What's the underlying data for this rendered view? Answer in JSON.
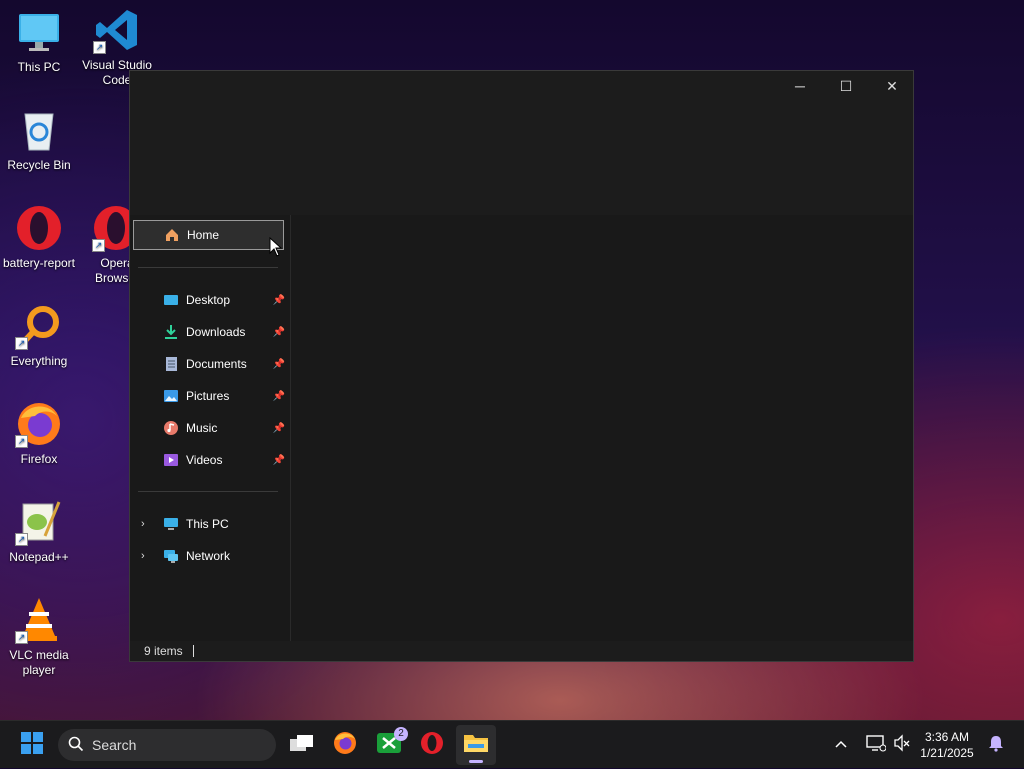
{
  "desktop": {
    "icons": [
      {
        "label": "This PC",
        "icon": "monitor-icon"
      },
      {
        "label": "Visual Studio Code",
        "icon": "vscode-icon"
      },
      {
        "label": "Recycle Bin",
        "icon": "recycle-bin-icon"
      },
      {
        "label": "battery-report",
        "icon": "opera-icon"
      },
      {
        "label": "Opera Browser",
        "icon": "opera-icon"
      },
      {
        "label": "Everything",
        "icon": "everything-search-icon"
      },
      {
        "label": "Firefox",
        "icon": "firefox-icon"
      },
      {
        "label": "Notepad++",
        "icon": "notepadpp-icon"
      },
      {
        "label": "VLC media player",
        "icon": "vlc-icon"
      }
    ]
  },
  "explorer": {
    "nav": {
      "home": "Home",
      "quick_access": [
        {
          "label": "Desktop",
          "icon": "desktop-folder-icon",
          "pinned": true
        },
        {
          "label": "Downloads",
          "icon": "download-icon",
          "pinned": true
        },
        {
          "label": "Documents",
          "icon": "documents-icon",
          "pinned": true
        },
        {
          "label": "Pictures",
          "icon": "pictures-icon",
          "pinned": true
        },
        {
          "label": "Music",
          "icon": "music-icon",
          "pinned": true
        },
        {
          "label": "Videos",
          "icon": "videos-icon",
          "pinned": true
        }
      ],
      "locations": [
        {
          "label": "This PC",
          "icon": "monitor-icon"
        },
        {
          "label": "Network",
          "icon": "network-icon"
        }
      ]
    },
    "status": {
      "items_count": "9 items"
    },
    "window_controls": {
      "minimize": "─",
      "maximize": "☐",
      "close": "✕"
    }
  },
  "taskbar": {
    "search_placeholder": "Search",
    "apps": [
      {
        "name": "task-view",
        "icon": "task-view-icon"
      },
      {
        "name": "firefox",
        "icon": "firefox-icon"
      },
      {
        "name": "xbox",
        "icon": "xbox-icon",
        "badge": "2"
      },
      {
        "name": "opera",
        "icon": "opera-icon"
      },
      {
        "name": "file-explorer",
        "icon": "folder-icon",
        "active": true
      }
    ],
    "clock": {
      "time": "3:36 AM",
      "date": "1/21/2025"
    }
  },
  "colors": {
    "accent": "#0078d4",
    "window_bg": "#1c1c1c",
    "taskbar_bg": "#1b1b1d"
  }
}
